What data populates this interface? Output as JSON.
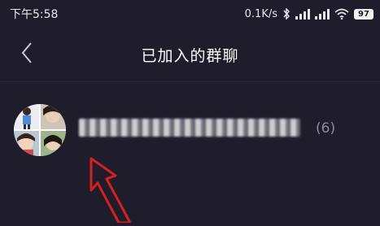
{
  "status_bar": {
    "time": "下午5:58",
    "net_speed": "0.1K/s",
    "battery_level": "97",
    "icons": [
      "bluetooth-icon",
      "signal-icon",
      "signal-icon",
      "wifi-icon",
      "battery-icon"
    ]
  },
  "nav": {
    "title": "已加入的群聊",
    "back_icon": "chevron-left-icon"
  },
  "groups": [
    {
      "name": "████████████████████████████",
      "count": "(6)"
    }
  ],
  "annotation": {
    "icon": "red-arrow-icon",
    "color": "#d42020"
  },
  "colors": {
    "background": "#1f1d2b",
    "title": "#ffffff",
    "muted": "#8e8c9c"
  }
}
